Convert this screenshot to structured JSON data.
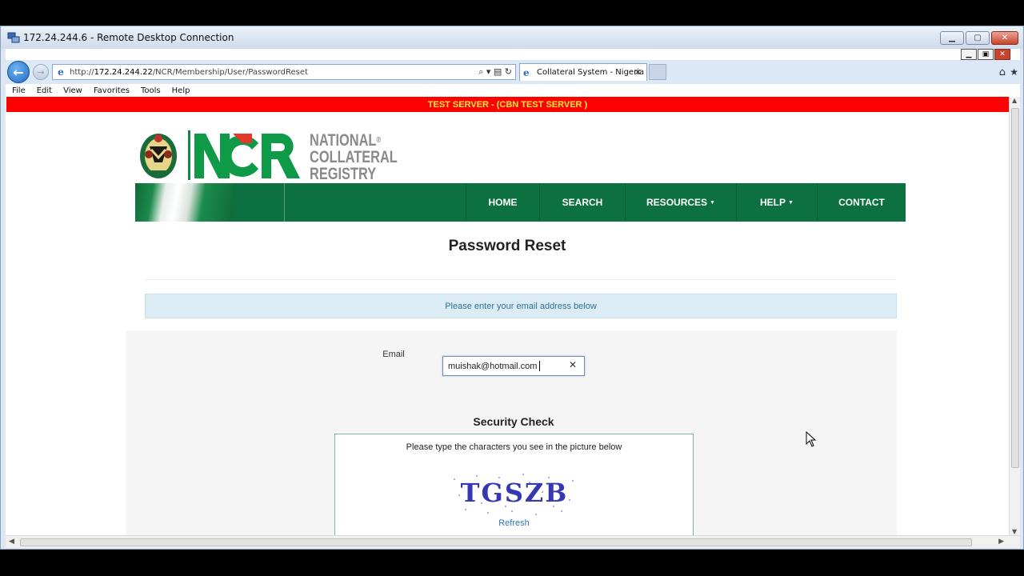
{
  "rdp": {
    "title": "172.24.244.6 - Remote Desktop Connection",
    "min_label": "▁",
    "max_label": "▢",
    "close_label": "✕"
  },
  "ie": {
    "inner_min": "▁",
    "inner_restore": "▣",
    "inner_close": "✕",
    "back_glyph": "←",
    "forward_glyph": "→",
    "address_prefix": "http://",
    "address_host": "172.24.244.22",
    "address_path": "/NCR/Membership/User/PasswordReset",
    "address_tools": "⌕ ▾  ▤ ↻",
    "tab_title": "Collateral System - Nigeria",
    "tab_close": "✕",
    "home_glyph": "⌂",
    "fav_glyph": "★",
    "menu": [
      "File",
      "Edit",
      "View",
      "Favorites",
      "Tools",
      "Help"
    ]
  },
  "page": {
    "banner": "TEST SERVER - (CBN TEST SERVER )",
    "brand_line1": "NATIONAL",
    "brand_reg": "®",
    "brand_line2": "COLLATERAL",
    "brand_line3": "REGISTRY",
    "nav": {
      "home": "HOME",
      "search": "SEARCH",
      "resources": "RESOURCES",
      "help": "HELP",
      "contact": "CONTACT",
      "caret": "▼"
    },
    "title": "Password Reset",
    "info": "Please enter your email address below",
    "email_label": "Email",
    "email_value": "muishak@hotmail.com",
    "clear_glyph": "✕",
    "security_title": "Security Check",
    "security_instr": "Please type the characters you see in the picture below",
    "captcha_text": "TGSZB",
    "refresh": "Refresh"
  },
  "colors": {
    "nav_green": "#0d7040",
    "banner_red": "#ff0000",
    "banner_text": "#ffeb3b",
    "info_bg": "#dcecf5",
    "link_blue": "#2a7ab8"
  }
}
